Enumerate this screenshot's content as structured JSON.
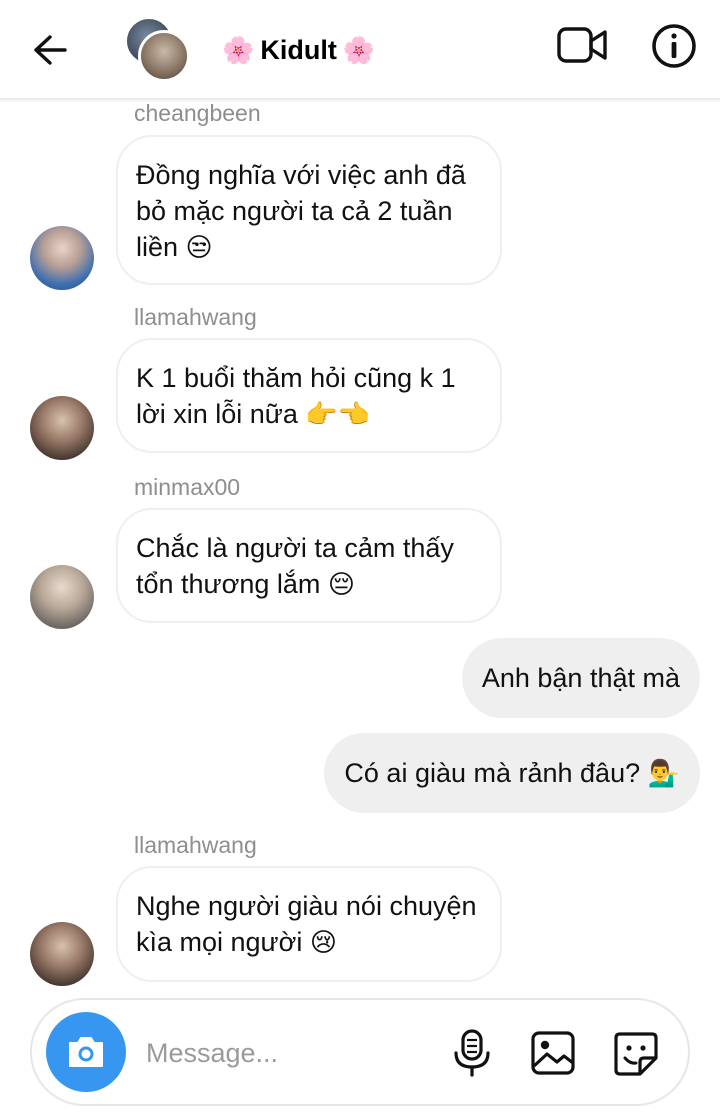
{
  "header": {
    "title": "Kidult",
    "title_decoration": "🌸"
  },
  "messages": [
    {
      "sender": "cheangbeen",
      "text": "Đồng nghĩa với việc anh đã bỏ mặc người ta cả 2 tuần liền",
      "emoji": "😒"
    },
    {
      "sender": "llamahwang",
      "text": "K 1 buổi thăm hỏi cũng k 1 lời xin lỗi nữa",
      "emoji": "👉👈"
    },
    {
      "sender": "minmax00",
      "text": "Chắc là người ta cảm thấy tổn thương lắm",
      "emoji": "😔"
    },
    {
      "outgoing": true,
      "text": "Anh bận thật mà"
    },
    {
      "outgoing": true,
      "text": "Có ai giàu mà rảnh đâu?",
      "emoji": "💁‍♂️"
    },
    {
      "sender": "llamahwang",
      "text": "Nghe người giàu nói chuyện kìa mọi người",
      "emoji": "😢"
    }
  ],
  "composer": {
    "placeholder": "Message..."
  },
  "colors": {
    "accent": "#3797f0",
    "outgoing_bubble": "#efefef",
    "username": "#8e8e8e"
  },
  "icons": [
    "back-arrow-icon",
    "video-call-icon",
    "info-icon",
    "camera-icon",
    "microphone-icon",
    "gallery-icon",
    "sticker-icon"
  ]
}
